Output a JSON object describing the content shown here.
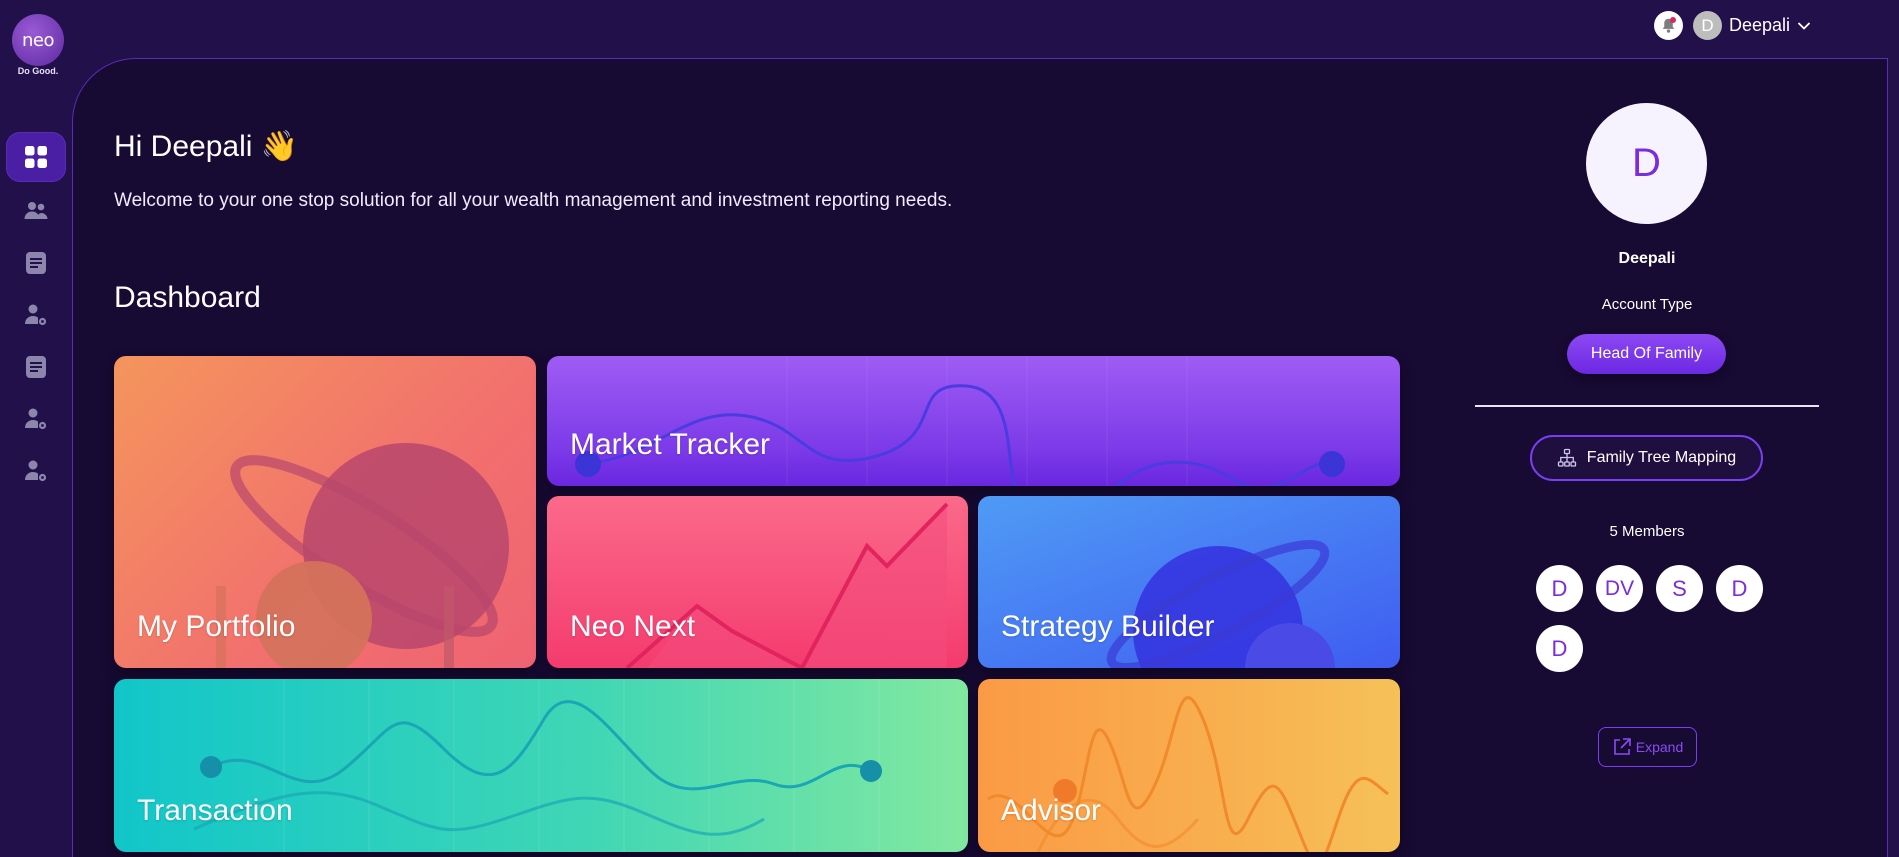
{
  "brand": {
    "logo_text": "neo",
    "tagline": "Do Good."
  },
  "sidebar": {
    "items": [
      {
        "name": "dashboard",
        "icon": "grid-icon",
        "active": true
      },
      {
        "name": "clients",
        "icon": "users-icon",
        "active": false
      },
      {
        "name": "reports",
        "icon": "document-icon",
        "active": false
      },
      {
        "name": "user-settings",
        "icon": "user-gear-icon",
        "active": false
      },
      {
        "name": "statements",
        "icon": "document-icon",
        "active": false
      },
      {
        "name": "user-settings-2",
        "icon": "user-gear-icon",
        "active": false
      },
      {
        "name": "user-settings-3",
        "icon": "user-gear-icon",
        "active": false
      }
    ]
  },
  "topbar": {
    "user_initial": "D",
    "user_name": "Deepali"
  },
  "main": {
    "greeting": "Hi Deepali 👋",
    "welcome": "Welcome to your one stop solution for all your wealth management and investment reporting needs.",
    "dashboard_title": "Dashboard",
    "cards": {
      "portfolio": "My Portfolio",
      "market": "Market Tracker",
      "neonext": "Neo Next",
      "strategy": "Strategy Builder",
      "transaction": "Transaction",
      "advisor": "Advisor"
    }
  },
  "profile": {
    "initial": "D",
    "name": "Deepali",
    "account_type_label": "Account Type",
    "account_type": "Head Of Family",
    "family_tree_button": "Family Tree Mapping",
    "members_count": "5 Members",
    "members": [
      "D",
      "DV",
      "S",
      "D",
      "D"
    ],
    "expand_button": "Expand"
  },
  "colors": {
    "accent": "#7b3ff0",
    "background": "#170a33",
    "rail": "#22104a"
  }
}
